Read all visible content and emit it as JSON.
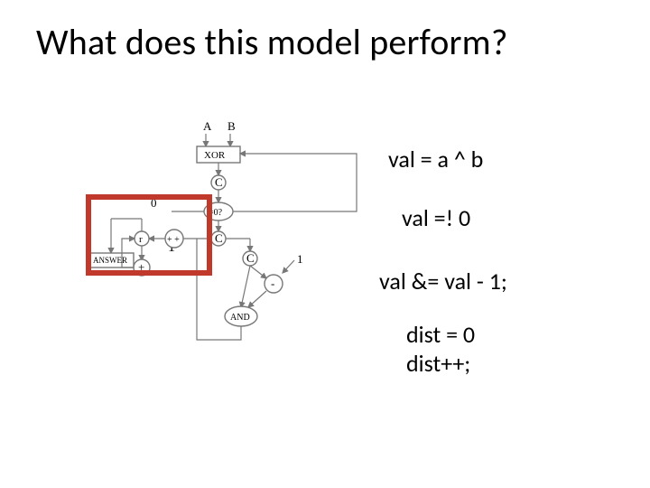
{
  "title": "What does this model perform?",
  "code": {
    "l1": "val = a ^ b",
    "l2": "val =! 0",
    "l3": "val &= val - 1;",
    "l4a": "dist = 0",
    "l4b": "dist++;"
  },
  "diagram": {
    "input_a": "A",
    "input_b": "B",
    "c": "C",
    "zero": "0",
    "one_small": "1",
    "one_large": "1",
    "xor": "XOR",
    "neq": "=0?",
    "minus": "-",
    "and": "AND",
    "plus": "+",
    "step": "+ +",
    "answer": "ANSWER"
  }
}
